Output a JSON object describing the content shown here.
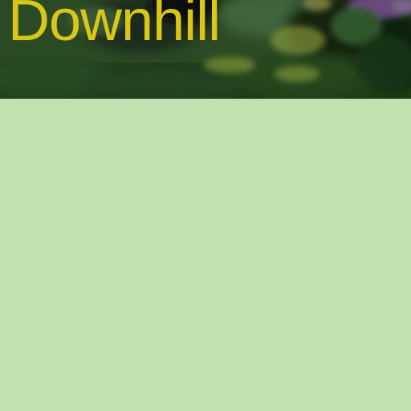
{
  "header": {
    "title": "Downhill",
    "background_image": "blurred-garden-photo",
    "title_color": "#d8c718"
  },
  "content": {
    "background_color": "#c1e1b0"
  }
}
